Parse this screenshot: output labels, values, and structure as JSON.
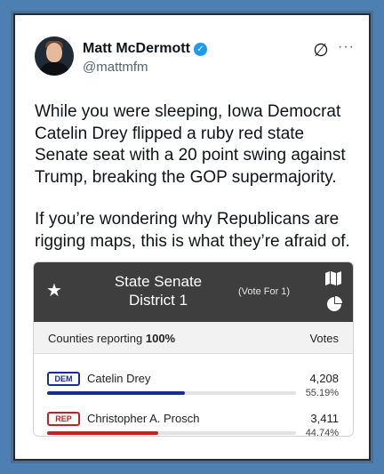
{
  "author": {
    "display_name": "Matt McDermott",
    "handle": "@mattmfm",
    "verified": true
  },
  "icons": {
    "grok": "∅",
    "more": "···",
    "verified": "✓",
    "star": "★"
  },
  "tweet": {
    "paragraph1": "While you were sleeping, Iowa Democrat Catelin Drey flipped a ruby red state Senate seat with a 20 point swing against Trump, breaking the GOP supermajority.",
    "paragraph2": "If you’re wondering why Republicans are rigging maps, this is what they’re afraid of."
  },
  "results": {
    "race_line1": "State Senate",
    "race_line2": "District 1",
    "vote_for": "(Vote For 1)",
    "counties_label": "Counties reporting",
    "counties_pct": "100%",
    "votes_header": "Votes",
    "header_color": "#3e3e3e",
    "candidates": [
      {
        "party": "DEM",
        "name": "Catelin Drey",
        "votes": "4,208",
        "pct_label": "55.19%",
        "share": 0.5519,
        "color": "#1a2d8f"
      },
      {
        "party": "REP",
        "name": "Christopher A. Prosch",
        "votes": "3,411",
        "pct_label": "44.74%",
        "share": 0.4474,
        "color": "#c62020"
      }
    ]
  }
}
